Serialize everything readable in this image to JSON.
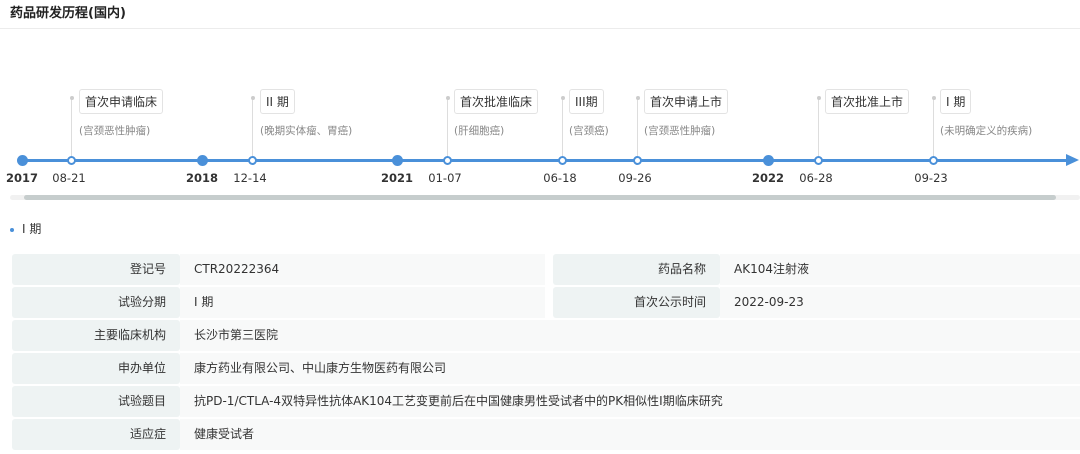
{
  "title": "药品研发历程(国内)",
  "timeline": {
    "years": [
      "2017",
      "2018",
      "2021",
      "2022"
    ],
    "events": [
      {
        "date": "08-21",
        "label": "首次申请临床",
        "sub": "(宫颈恶性肿瘤)"
      },
      {
        "date": "12-14",
        "label": "II 期",
        "sub": "(晚期实体瘤、胃癌)"
      },
      {
        "date": "01-07",
        "label": "首次批准临床",
        "sub": "(肝细胞癌)"
      },
      {
        "date": "06-18",
        "label": "III期",
        "sub": "(宫颈癌)"
      },
      {
        "date": "09-26",
        "label": "首次申请上市",
        "sub": "(宫颈恶性肿瘤)"
      },
      {
        "date": "06-28",
        "label": "首次批准上市",
        "sub": ""
      },
      {
        "date": "09-23",
        "label": "I 期",
        "sub": "(未明确定义的疾病)"
      }
    ]
  },
  "section": "I 期",
  "details": {
    "reg_no_label": "登记号",
    "reg_no": "CTR20222364",
    "drug_label": "药品名称",
    "drug": "AK104注射液",
    "phase_label": "试验分期",
    "phase": "I 期",
    "pub_label": "首次公示时间",
    "pub": "2022-09-23",
    "inst_label": "主要临床机构",
    "inst": "长沙市第三医院",
    "sponsor_label": "申办单位",
    "sponsor": "康方药业有限公司、中山康方生物医药有限公司",
    "topic_label": "试验题目",
    "topic": "抗PD-1/CTLA-4双特异性抗体AK104工艺变更前后在中国健康男性受试者中的PK相似性I期临床研究",
    "ind_label": "适应症",
    "ind": "健康受试者"
  }
}
